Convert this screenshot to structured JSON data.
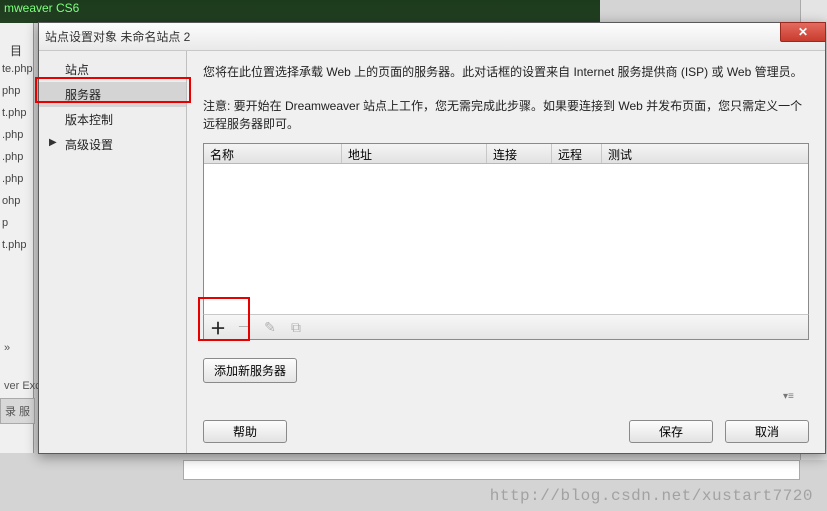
{
  "bg": {
    "app_title_fragment": "mweaver CS6",
    "heading": "目",
    "files": [
      "te.php",
      "php",
      "t.php",
      ".php",
      ".php",
      ".php",
      "ohp",
      "p",
      "t.php"
    ],
    "arrows": "»",
    "exc": "ver Exc",
    "bottom_tabs": "录   服"
  },
  "dialog": {
    "title": "站点设置对象 未命名站点 2",
    "close_glyph": "✕"
  },
  "sidebar": {
    "items": [
      {
        "label": "站点",
        "has_arrow": false
      },
      {
        "label": "服务器",
        "has_arrow": false,
        "selected": true
      },
      {
        "label": "版本控制",
        "has_arrow": false
      },
      {
        "label": "高级设置",
        "has_arrow": true
      }
    ]
  },
  "content": {
    "desc": "您将在此位置选择承载 Web 上的页面的服务器。此对话框的设置来自 Internet 服务提供商 (ISP) 或 Web 管理员。",
    "note": "注意: 要开始在 Dreamweaver 站点上工作，您无需完成此步骤。如果要连接到 Web 并发布页面，您只需定义一个远程服务器即可。",
    "columns": {
      "name": "名称",
      "addr": "地址",
      "conn": "连接",
      "remote": "远程",
      "test": "测试"
    },
    "toolbar": {
      "plus": "＋",
      "minus": "－",
      "edit": "✎",
      "dup": "⧉"
    },
    "add_server": "添加新服务器"
  },
  "buttons": {
    "help": "帮助",
    "save": "保存",
    "cancel": "取消"
  },
  "watermark": "http://blog.csdn.net/xustart7720"
}
